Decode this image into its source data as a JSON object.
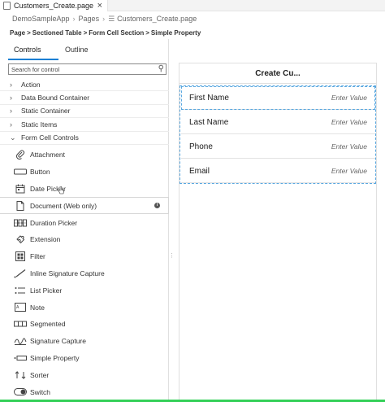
{
  "editor_tab": {
    "label": "Customers_Create.page",
    "close": "×"
  },
  "path": {
    "app": "DemoSampleApp",
    "folder": "Pages",
    "file": "Customers_Create.page"
  },
  "breadcrumb": [
    "Page",
    "Sectioned Table",
    "Form Cell Section",
    "Simple Property"
  ],
  "panel": {
    "tabs": [
      "Controls",
      "Outline"
    ],
    "search_placeholder": "Search for control",
    "groups": [
      {
        "label": "Action",
        "expanded": false
      },
      {
        "label": "Data Bound Container",
        "expanded": false
      },
      {
        "label": "Static Container",
        "expanded": false
      },
      {
        "label": "Static Items",
        "expanded": false
      },
      {
        "label": "Form Cell Controls",
        "expanded": true
      }
    ],
    "items": [
      {
        "label": "Attachment",
        "icon": "paperclip-icon"
      },
      {
        "label": "Button",
        "icon": "button-icon"
      },
      {
        "label": "Date Picker",
        "icon": "calendar-icon"
      },
      {
        "label": "Document (Web only)",
        "icon": "document-icon",
        "info": "i"
      },
      {
        "label": "Duration Picker",
        "icon": "duration-icon"
      },
      {
        "label": "Extension",
        "icon": "puzzle-icon"
      },
      {
        "label": "Filter",
        "icon": "filter-icon"
      },
      {
        "label": "Inline Signature Capture",
        "icon": "signature-pen-icon"
      },
      {
        "label": "List Picker",
        "icon": "list-picker-icon"
      },
      {
        "label": "Note",
        "icon": "note-icon"
      },
      {
        "label": "Segmented",
        "icon": "segmented-icon"
      },
      {
        "label": "Signature Capture",
        "icon": "signature-capture-icon"
      },
      {
        "label": "Simple Property",
        "icon": "simple-property-icon"
      },
      {
        "label": "Sorter",
        "icon": "sorter-icon"
      },
      {
        "label": "Switch",
        "icon": "switch-icon"
      }
    ]
  },
  "canvas": {
    "title": "Create Cu...",
    "rows": [
      {
        "label": "First Name",
        "placeholder": "Enter Value"
      },
      {
        "label": "Last Name",
        "placeholder": "Enter Value"
      },
      {
        "label": "Phone",
        "placeholder": "Enter Value"
      },
      {
        "label": "Email",
        "placeholder": "Enter Value"
      }
    ]
  },
  "colors": {
    "accent": "#1a7fd4",
    "status": "#34d058",
    "selection": "#5aa8e0"
  }
}
